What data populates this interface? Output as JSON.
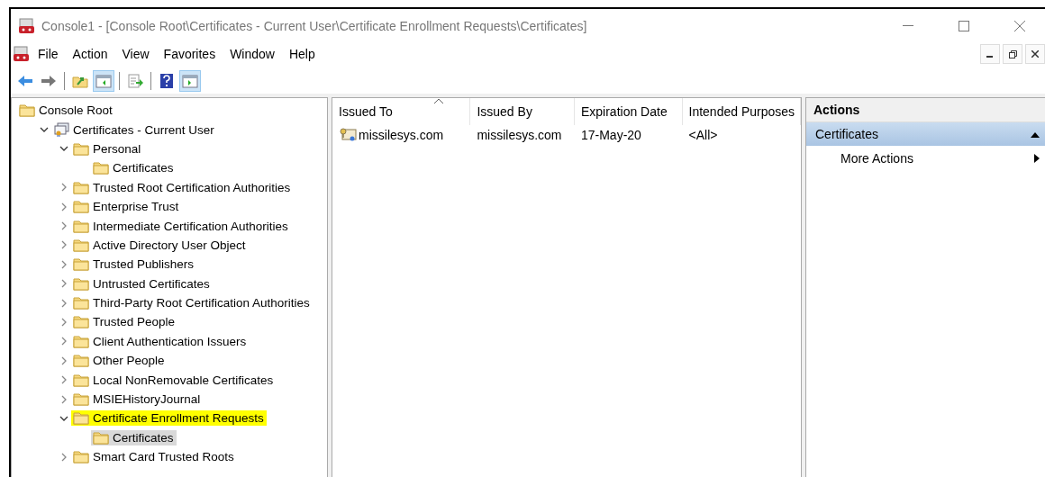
{
  "window": {
    "title": "Console1 - [Console Root\\Certificates - Current User\\Certificate Enrollment Requests\\Certificates]"
  },
  "menu": [
    "File",
    "Action",
    "View",
    "Favorites",
    "Window",
    "Help"
  ],
  "toolbar": [
    {
      "kind": "back",
      "pressed": false
    },
    {
      "kind": "forward",
      "pressed": false
    },
    {
      "kind": "separator"
    },
    {
      "kind": "up",
      "pressed": false
    },
    {
      "kind": "tree",
      "pressed": true
    },
    {
      "kind": "separator"
    },
    {
      "kind": "export",
      "pressed": false
    },
    {
      "kind": "separator"
    },
    {
      "kind": "help",
      "pressed": false
    },
    {
      "kind": "actionpane",
      "pressed": true
    }
  ],
  "tree": [
    {
      "label": "Console Root",
      "kind": "folder",
      "selected": false,
      "highlighted": false,
      "children": [
        {
          "label": "Certificates - Current User",
          "kind": "snapin",
          "expanded": true,
          "selected": false,
          "highlighted": false,
          "children": [
            {
              "label": "Personal",
              "kind": "folder",
              "expanded": true,
              "selected": false,
              "highlighted": false,
              "children": [
                {
                  "label": "Certificates",
                  "kind": "folder",
                  "selected": false,
                  "highlighted": false
                }
              ]
            },
            {
              "label": "Trusted Root Certification Authorities",
              "kind": "folder",
              "expanded": false,
              "selected": false,
              "highlighted": false
            },
            {
              "label": "Enterprise Trust",
              "kind": "folder",
              "expanded": false,
              "selected": false,
              "highlighted": false
            },
            {
              "label": "Intermediate Certification Authorities",
              "kind": "folder",
              "expanded": false,
              "selected": false,
              "highlighted": false
            },
            {
              "label": "Active Directory User Object",
              "kind": "folder",
              "expanded": false,
              "selected": false,
              "highlighted": false
            },
            {
              "label": "Trusted Publishers",
              "kind": "folder",
              "expanded": false,
              "selected": false,
              "highlighted": false
            },
            {
              "label": "Untrusted Certificates",
              "kind": "folder",
              "expanded": false,
              "selected": false,
              "highlighted": false
            },
            {
              "label": "Third-Party Root Certification Authorities",
              "kind": "folder",
              "expanded": false,
              "selected": false,
              "highlighted": false
            },
            {
              "label": "Trusted People",
              "kind": "folder",
              "expanded": false,
              "selected": false,
              "highlighted": false
            },
            {
              "label": "Client Authentication Issuers",
              "kind": "folder",
              "expanded": false,
              "selected": false,
              "highlighted": false
            },
            {
              "label": "Other People",
              "kind": "folder",
              "expanded": false,
              "selected": false,
              "highlighted": false
            },
            {
              "label": "Local NonRemovable Certificates",
              "kind": "folder",
              "expanded": false,
              "selected": false,
              "highlighted": false
            },
            {
              "label": "MSIEHistoryJournal",
              "kind": "folder",
              "expanded": false,
              "selected": false,
              "highlighted": false
            },
            {
              "label": "Certificate Enrollment Requests",
              "kind": "folder",
              "expanded": true,
              "selected": false,
              "highlighted": true,
              "children": [
                {
                  "label": "Certificates",
                  "kind": "folder",
                  "selected": true,
                  "highlighted": false
                }
              ]
            },
            {
              "label": "Smart Card Trusted Roots",
              "kind": "folder",
              "expanded": false,
              "selected": false,
              "highlighted": false
            }
          ]
        }
      ]
    }
  ],
  "list": {
    "columns": [
      {
        "label": "Issued To",
        "sorted": true
      },
      {
        "label": "Issued By",
        "sorted": false
      },
      {
        "label": "Expiration Date",
        "sorted": false
      },
      {
        "label": "Intended Purposes",
        "sorted": false
      }
    ],
    "rows": [
      [
        "missilesys.com",
        "missilesys.com",
        "17-May-20",
        "<All>"
      ]
    ]
  },
  "actions": {
    "title": "Actions",
    "sections": [
      {
        "label": "Certificates",
        "expanded": true,
        "items": [
          "More Actions"
        ]
      }
    ]
  }
}
